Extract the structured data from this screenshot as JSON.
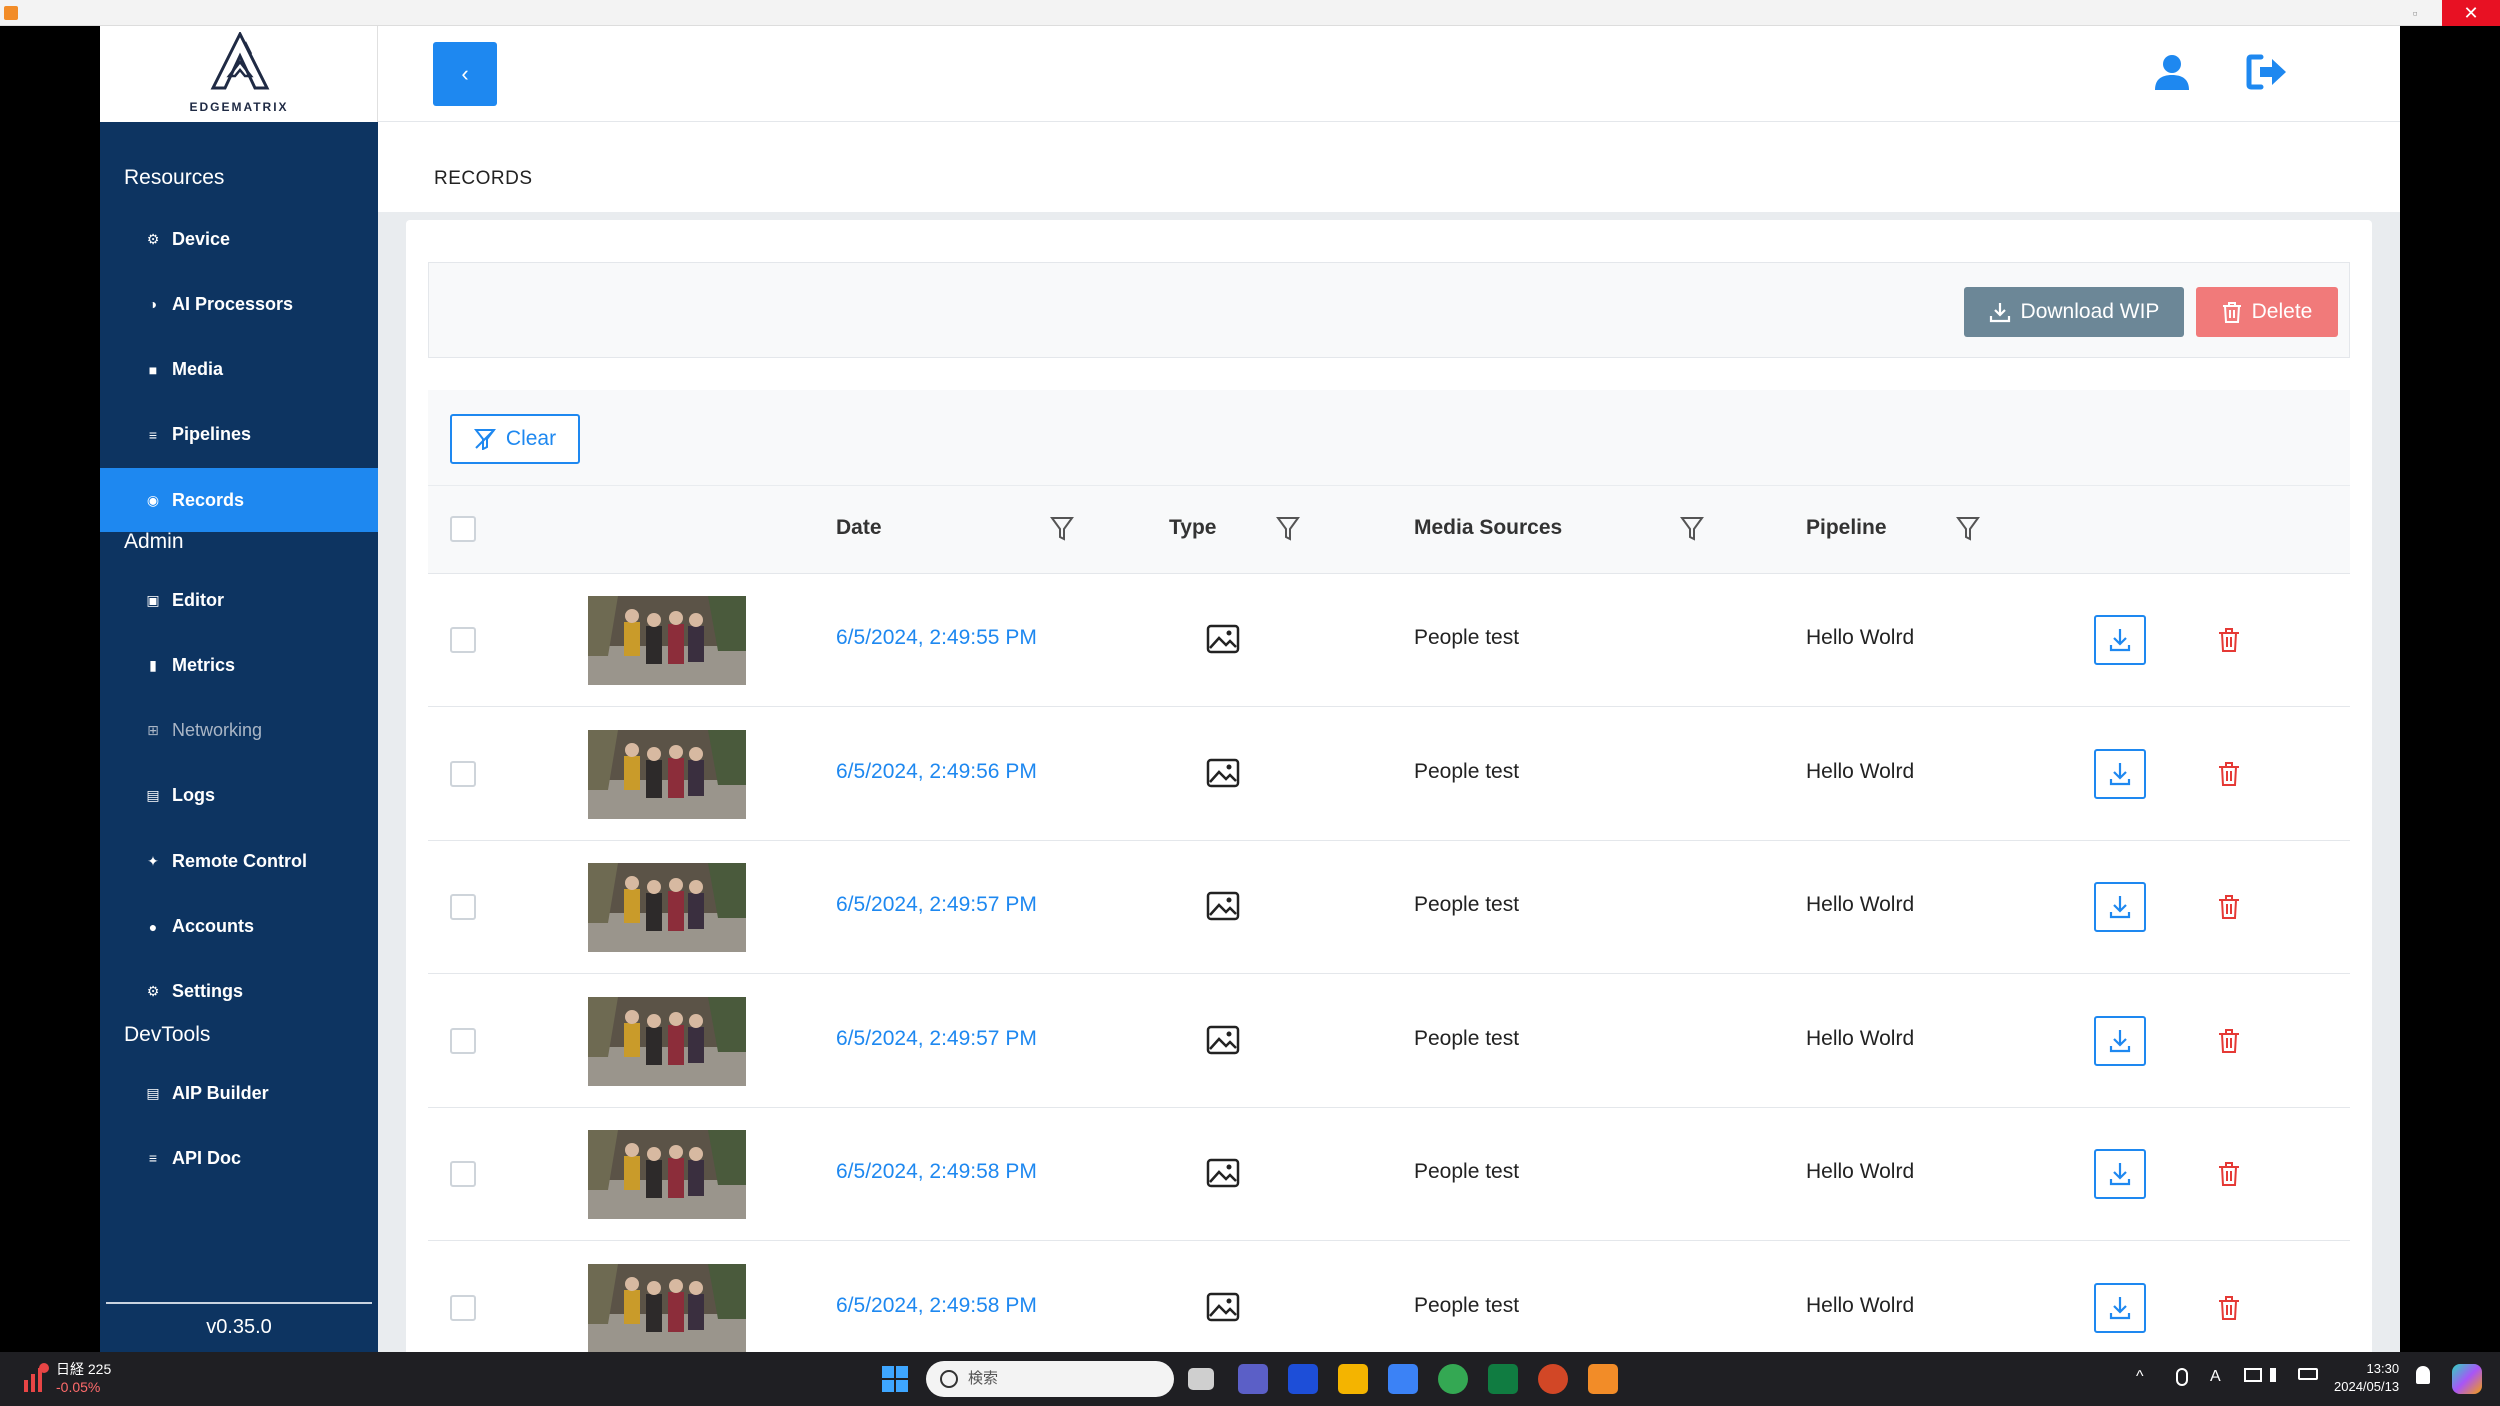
{
  "window": {
    "close_glyph": "✕",
    "restore_glyph": "▫"
  },
  "logo": {
    "text": "EDGEMATRIX"
  },
  "sidebar": {
    "sections": [
      {
        "title": "Resources",
        "items": [
          {
            "label": "Device",
            "icon": "gear-icon",
            "active": false
          },
          {
            "label": "AI Processors",
            "icon": "brain-icon",
            "active": false
          },
          {
            "label": "Media",
            "icon": "video-camera-icon",
            "active": false
          },
          {
            "label": "Pipelines",
            "icon": "list-icon",
            "active": false
          },
          {
            "label": "Records",
            "icon": "record-icon",
            "active": true
          }
        ]
      },
      {
        "title": "Admin",
        "items": [
          {
            "label": "Editor",
            "icon": "editor-icon",
            "active": false
          },
          {
            "label": "Metrics",
            "icon": "bar-chart-icon",
            "active": false
          },
          {
            "label": "Networking",
            "icon": "network-icon",
            "active": false,
            "dim": true
          },
          {
            "label": "Logs",
            "icon": "clipboard-icon",
            "active": false
          },
          {
            "label": "Remote Control",
            "icon": "remote-icon",
            "active": false
          },
          {
            "label": "Accounts",
            "icon": "users-icon",
            "active": false
          },
          {
            "label": "Settings",
            "icon": "settings-icon",
            "active": false
          }
        ]
      },
      {
        "title": "DevTools",
        "items": [
          {
            "label": "AIP Builder",
            "icon": "builder-icon",
            "active": false
          },
          {
            "label": "API Doc",
            "icon": "list-icon",
            "active": false
          }
        ]
      }
    ],
    "version": "v0.35.0"
  },
  "header": {
    "back_glyph": "‹",
    "breadcrumb": "RECORDS"
  },
  "toolbar": {
    "download_label": "Download WIP",
    "delete_label": "Delete"
  },
  "filters": {
    "clear_label": "Clear"
  },
  "table": {
    "columns": {
      "date": "Date",
      "type": "Type",
      "media": "Media Sources",
      "pipeline": "Pipeline"
    },
    "rows": [
      {
        "date": "6/5/2024, 2:49:55 PM",
        "media": "People test",
        "pipeline": "Hello Wolrd"
      },
      {
        "date": "6/5/2024, 2:49:56 PM",
        "media": "People test",
        "pipeline": "Hello Wolrd"
      },
      {
        "date": "6/5/2024, 2:49:57 PM",
        "media": "People test",
        "pipeline": "Hello Wolrd"
      },
      {
        "date": "6/5/2024, 2:49:57 PM",
        "media": "People test",
        "pipeline": "Hello Wolrd"
      },
      {
        "date": "6/5/2024, 2:49:58 PM",
        "media": "People test",
        "pipeline": "Hello Wolrd"
      },
      {
        "date": "6/5/2024, 2:49:58 PM",
        "media": "People test",
        "pipeline": "Hello Wolrd"
      }
    ]
  },
  "taskbar": {
    "stock_name": "日経 225",
    "stock_change": "-0.05%",
    "search_placeholder": "検索",
    "clock_time": "13:30",
    "clock_date": "2024/05/13",
    "tray_up": "^",
    "tray_ime": "A"
  },
  "colors": {
    "sidebar": "#0d3461",
    "accent": "#1e88f0",
    "danger": "#f17a7a",
    "secondary": "#6c8797"
  }
}
